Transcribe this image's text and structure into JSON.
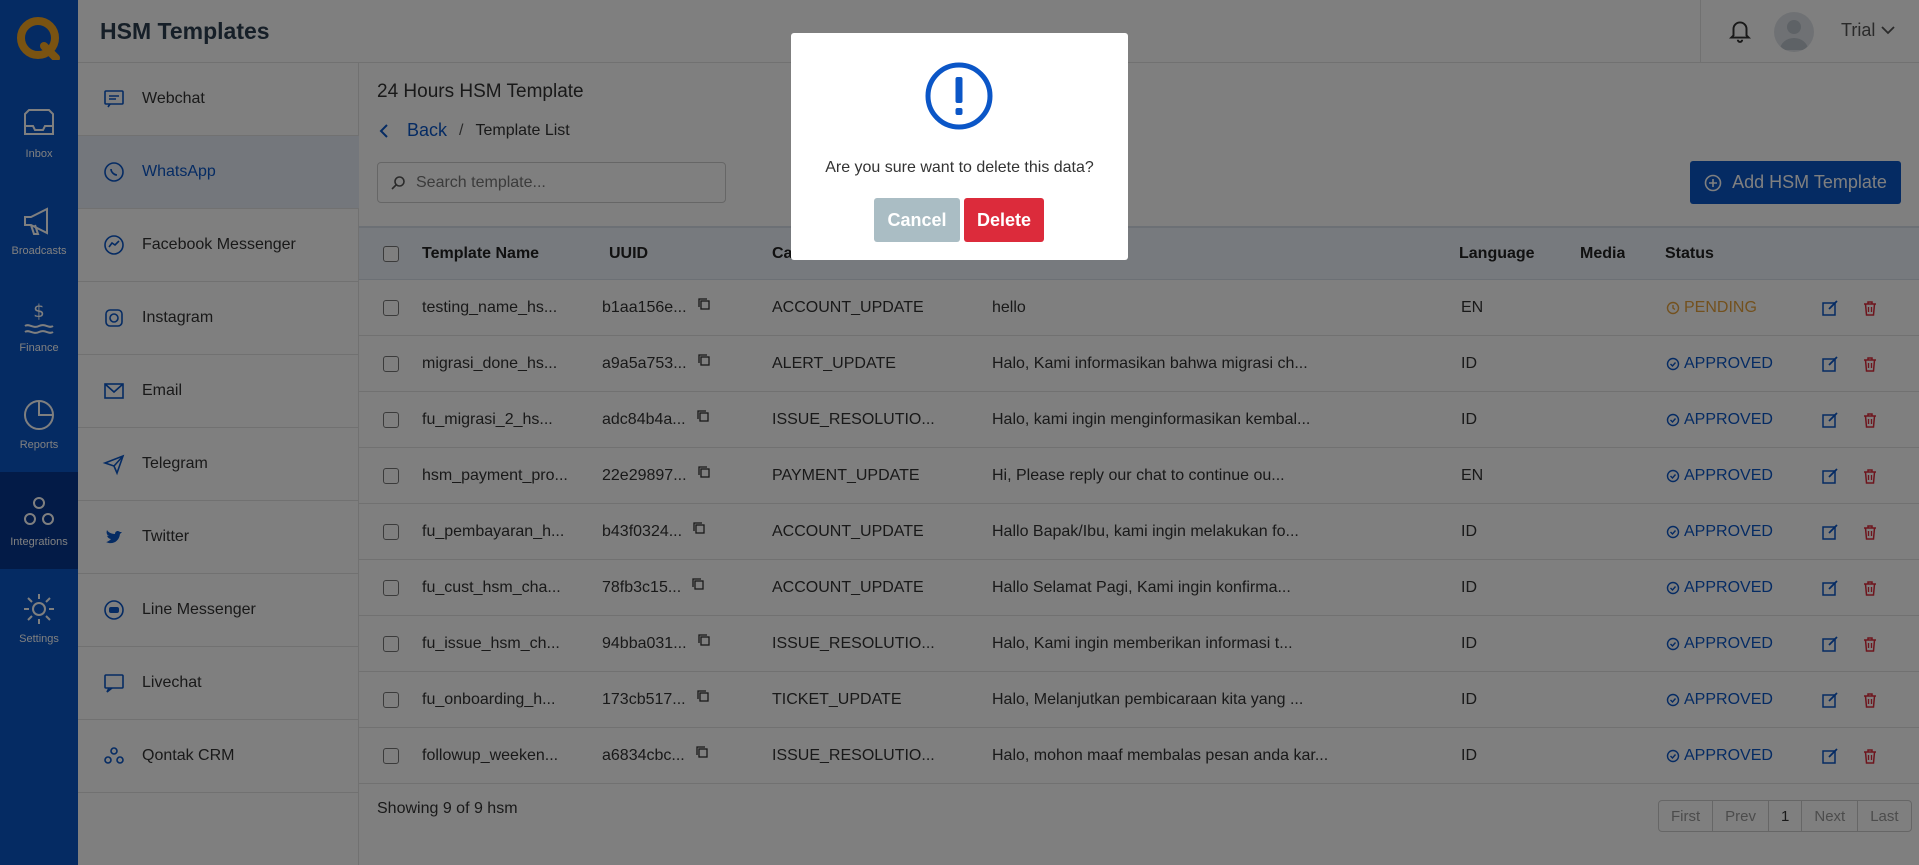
{
  "app": {
    "title": "HSM Templates"
  },
  "rail": {
    "items": [
      {
        "label": "Inbox",
        "icon": "inbox-icon"
      },
      {
        "label": "Broadcasts",
        "icon": "megaphone-icon"
      },
      {
        "label": "Finance",
        "icon": "finance-icon"
      },
      {
        "label": "Reports",
        "icon": "pie-chart-icon"
      },
      {
        "label": "Integrations",
        "icon": "integrations-icon",
        "active": true
      },
      {
        "label": "Settings",
        "icon": "gear-icon"
      }
    ]
  },
  "user": {
    "name": "Trial"
  },
  "subnav": {
    "items": [
      {
        "label": "Webchat",
        "icon": "webchat-icon"
      },
      {
        "label": "WhatsApp",
        "icon": "whatsapp-icon",
        "active": true
      },
      {
        "label": "Facebook Messenger",
        "icon": "messenger-icon"
      },
      {
        "label": "Instagram",
        "icon": "instagram-icon"
      },
      {
        "label": "Email",
        "icon": "email-icon"
      },
      {
        "label": "Telegram",
        "icon": "telegram-icon"
      },
      {
        "label": "Twitter",
        "icon": "twitter-icon"
      },
      {
        "label": "Line Messenger",
        "icon": "line-icon"
      },
      {
        "label": "Livechat",
        "icon": "livechat-icon"
      },
      {
        "label": "Qontak CRM",
        "icon": "crm-icon"
      }
    ]
  },
  "page": {
    "title": "24 Hours HSM Template",
    "breadcrumb": {
      "back": "Back",
      "separator": "/",
      "current": "Template List"
    },
    "search_placeholder": "Search template...",
    "add_button": "Add HSM Template"
  },
  "table": {
    "headers": {
      "name": "Template Name",
      "uuid": "UUID",
      "category": "Ca",
      "body": "",
      "language": "Language",
      "media": "Media",
      "status": "Status"
    },
    "rows": [
      {
        "name": "testing_name_hs...",
        "uuid": "b1aa156e...",
        "category": "ACCOUNT_UPDATE",
        "body": "hello",
        "language": "EN",
        "status": "PENDING"
      },
      {
        "name": "migrasi_done_hs...",
        "uuid": "a9a5a753...",
        "category": "ALERT_UPDATE",
        "body": "Halo, Kami informasikan bahwa migrasi ch...",
        "language": "ID",
        "status": "APPROVED"
      },
      {
        "name": "fu_migrasi_2_hs...",
        "uuid": "adc84b4a...",
        "category": "ISSUE_RESOLUTIO...",
        "body": "Halo, kami ingin menginformasikan kembal...",
        "language": "ID",
        "status": "APPROVED"
      },
      {
        "name": "hsm_payment_pro...",
        "uuid": "22e29897...",
        "category": "PAYMENT_UPDATE",
        "body": "Hi, Please reply our chat to continue ou...",
        "language": "EN",
        "status": "APPROVED"
      },
      {
        "name": "fu_pembayaran_h...",
        "uuid": "b43f0324...",
        "category": "ACCOUNT_UPDATE",
        "body": "Hallo Bapak/Ibu, kami ingin melakukan fo...",
        "language": "ID",
        "status": "APPROVED"
      },
      {
        "name": "fu_cust_hsm_cha...",
        "uuid": "78fb3c15...",
        "category": "ACCOUNT_UPDATE",
        "body": "Hallo Selamat Pagi, Kami ingin konfirma...",
        "language": "ID",
        "status": "APPROVED"
      },
      {
        "name": "fu_issue_hsm_ch...",
        "uuid": "94bba031...",
        "category": "ISSUE_RESOLUTIO...",
        "body": "Halo, Kami ingin memberikan informasi t...",
        "language": "ID",
        "status": "APPROVED"
      },
      {
        "name": "fu_onboarding_h...",
        "uuid": "173cb517...",
        "category": "TICKET_UPDATE",
        "body": "Halo, Melanjutkan pembicaraan kita yang ...",
        "language": "ID",
        "status": "APPROVED"
      },
      {
        "name": "followup_weeken...",
        "uuid": "a6834cbc...",
        "category": "ISSUE_RESOLUTIO...",
        "body": "Halo, mohon maaf membalas pesan anda kar...",
        "language": "ID",
        "status": "APPROVED"
      }
    ]
  },
  "footer": {
    "showing": "Showing 9 of 9 hsm",
    "pager": [
      "First",
      "Prev",
      "1",
      "Next",
      "Last"
    ]
  },
  "modal": {
    "message": "Are you sure want to delete this data?",
    "cancel": "Cancel",
    "delete": "Delete"
  },
  "colors": {
    "brand": "#0b56c7",
    "danger": "#dc2b3b",
    "pending": "#e6a23c",
    "logo": "#f5a623"
  }
}
